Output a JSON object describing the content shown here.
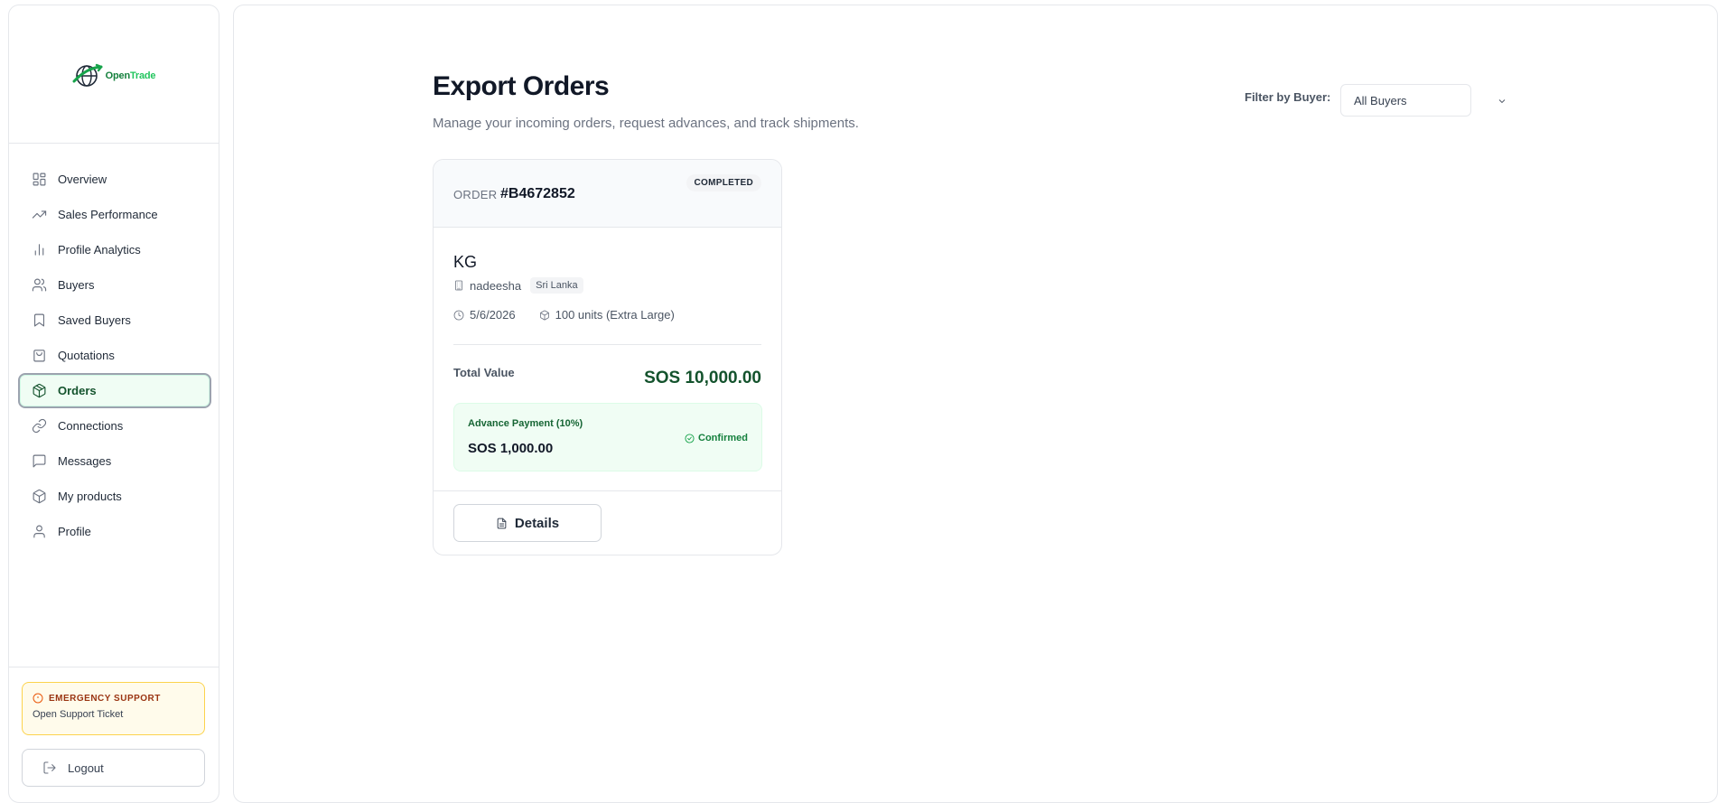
{
  "brand": {
    "name_part1": "Open",
    "name_part2": "Trade"
  },
  "sidebar": {
    "items": [
      {
        "label": "Overview",
        "icon": "grid-icon"
      },
      {
        "label": "Sales Performance",
        "icon": "trending-up-icon"
      },
      {
        "label": "Profile Analytics",
        "icon": "bar-chart-icon"
      },
      {
        "label": "Buyers",
        "icon": "users-icon"
      },
      {
        "label": "Saved Buyers",
        "icon": "bookmark-icon"
      },
      {
        "label": "Quotations",
        "icon": "shopping-bag-icon"
      },
      {
        "label": "Orders",
        "icon": "package-icon",
        "active": true
      },
      {
        "label": "Connections",
        "icon": "link-icon"
      },
      {
        "label": "Messages",
        "icon": "message-square-icon"
      },
      {
        "label": "My products",
        "icon": "box-icon"
      },
      {
        "label": "Profile",
        "icon": "user-icon"
      }
    ],
    "emergency": {
      "title": "EMERGENCY SUPPORT",
      "subtitle": "Open Support Ticket"
    },
    "logout_label": "Logout"
  },
  "main": {
    "title": "Export Orders",
    "subtitle": "Manage your incoming orders, request advances, and track shipments.",
    "filter": {
      "label": "Filter by Buyer:",
      "selected": "All Buyers"
    }
  },
  "order": {
    "label": "ORDER",
    "id": "#B4672852",
    "status": "COMPLETED",
    "buyer": "KG",
    "company": "nadeesha",
    "country": "Sri Lanka",
    "date": "5/6/2026",
    "quantity": "100 units (Extra Large)",
    "total_label": "Total Value",
    "total_value": "SOS 10,000.00",
    "advance_label": "Advance Payment (10%)",
    "advance_value": "SOS 1,000.00",
    "advance_status": "Confirmed",
    "details_label": "Details"
  },
  "colors": {
    "accent": "#14532d",
    "active_bg": "#f0fdf4",
    "warning_bg": "#fffbeb",
    "warning_text": "#9a3412"
  }
}
